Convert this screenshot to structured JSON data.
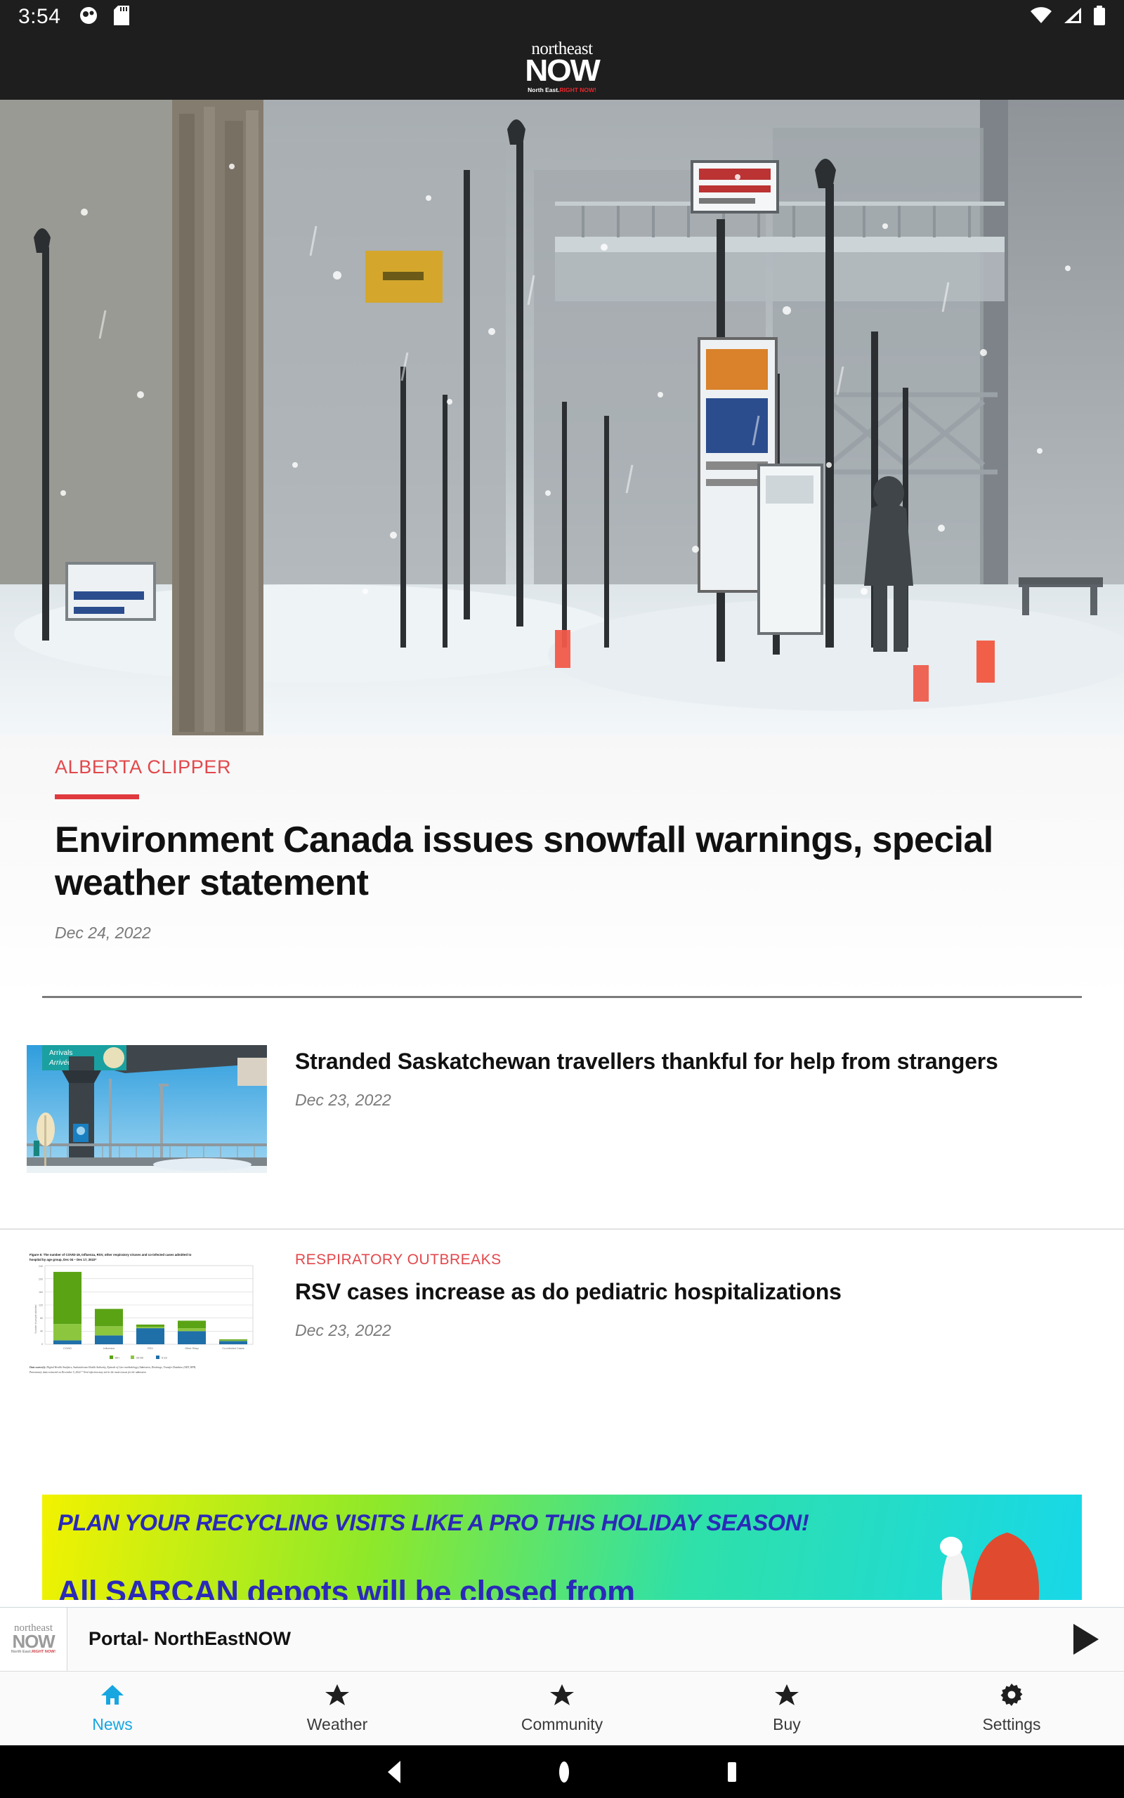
{
  "status_bar": {
    "time": "3:54",
    "left_icons": [
      "notification-icon",
      "sd-card-icon"
    ],
    "right_icons": [
      "wifi-icon",
      "cellular-signal-icon",
      "battery-icon"
    ],
    "background": "#1e1e1e"
  },
  "header": {
    "logo": {
      "line1": "northeast",
      "line2": "NOW",
      "tagline_white": "North East.",
      "tagline_red": "RIGHT NOW!",
      "accent_color": "#e8262d"
    }
  },
  "hero": {
    "alt": "snowy-city-street-blizzard",
    "overlay_signs": [
      "street-sign",
      "traffic-light",
      "bus-shelter-sign"
    ]
  },
  "featured": {
    "category": "ALBERTA CLIPPER",
    "category_color": "#e2484c",
    "rule_color": "#e03a3e",
    "headline": "Environment Canada issues snowfall warnings, special weather statement",
    "date": "Dec 24, 2022"
  },
  "articles": [
    {
      "kicker": "",
      "title": "Stranded Saskatchewan travellers thankful for help from strangers",
      "date": "Dec 23, 2022",
      "thumb": "airport-arrivals-sign-photo"
    },
    {
      "kicker": "RESPIRATORY OUTBREAKS",
      "title": "RSV cases increase as do pediatric hospitalizations",
      "date": "Dec 23, 2022",
      "thumb": "respiratory-hospitalization-bar-chart"
    }
  ],
  "ad_banner": {
    "line1": "PLAN YOUR RECYCLING VISITS LIKE A PRO THIS HOLIDAY SEASON!",
    "line2": "All SARCAN depots will be closed from",
    "text_color": "#2a2ab8",
    "gradient_start": "#f2f200",
    "gradient_end": "#18d8e8"
  },
  "audio_player": {
    "title": "Portal- NorthEastNOW",
    "play_icon": "play-icon",
    "logo": {
      "line1": "northeast",
      "line2": "NOW",
      "tagline_white": "North East.",
      "tagline_red": "RIGHT NOW!"
    }
  },
  "tab_bar": {
    "active_color": "#17a6e0",
    "items": [
      {
        "label": "News",
        "icon": "home-icon",
        "active": true
      },
      {
        "label": "Weather",
        "icon": "star-icon",
        "active": false
      },
      {
        "label": "Community",
        "icon": "star-icon",
        "active": false
      },
      {
        "label": "Buy",
        "icon": "star-icon",
        "active": false
      },
      {
        "label": "Settings",
        "icon": "gear-icon",
        "active": false
      }
    ]
  },
  "nav_bar": {
    "buttons": [
      "back-icon",
      "home-icon",
      "recents-icon"
    ]
  },
  "chart_data": {
    "type": "bar",
    "title": "Figure 5: The number of COVID-19, Influenza, RSV, other respiratory viruses and co-infected cases admitted to hospital by age group, Dec 04 – Dec 17, 2022*",
    "xlabel": "",
    "ylabel": "Number of people admitted",
    "ylim": [
      0,
      240
    ],
    "yticks": [
      0,
      40,
      80,
      120,
      160,
      200,
      240
    ],
    "grid": true,
    "legend_position": "bottom",
    "stacked": true,
    "categories": [
      "COVID",
      "Influenza",
      "RSV",
      "Other Resp",
      "Co-infected Cases"
    ],
    "series": [
      {
        "name": "0-19",
        "color": "#1f6fa8",
        "values": [
          12,
          27,
          49,
          40,
          10
        ]
      },
      {
        "name": "20-59",
        "color": "#8cc63f",
        "values": [
          50,
          28,
          4,
          9,
          2
        ]
      },
      {
        "name": "60+",
        "color": "#5aa315",
        "values": [
          159,
          53,
          7,
          23,
          3
        ]
      }
    ],
    "footnote": "Data source(s): Digital Health Analytics, Saskatchewan Health Authority, Episode of Care methodology (Admission, Discharge, Transfer Database (ADT, RPB, Panorama); data extracted on December 5, 2022 * Viral infection may not be the main reason for the admission"
  }
}
